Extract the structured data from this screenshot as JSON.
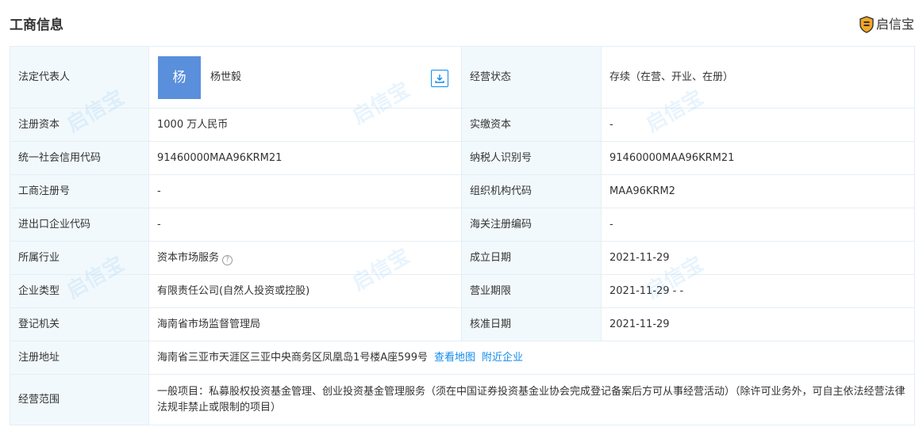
{
  "header": {
    "title": "工商信息",
    "brand": "启信宝"
  },
  "legal_rep": {
    "label": "法定代表人",
    "avatar_char": "杨",
    "name": "杨世毅"
  },
  "status": {
    "label": "经营状态",
    "value": "存续（在营、开业、在册）"
  },
  "rows": [
    {
      "l1": "注册资本",
      "v1": "1000 万人民币",
      "l2": "实缴资本",
      "v2": "-"
    },
    {
      "l1": "统一社会信用代码",
      "v1": "91460000MAA96KRM21",
      "l2": "纳税人识别号",
      "v2": "91460000MAA96KRM21"
    },
    {
      "l1": "工商注册号",
      "v1": "-",
      "l2": "组织机构代码",
      "v2": "MAA96KRM2"
    },
    {
      "l1": "进出口企业代码",
      "v1": "-",
      "l2": "海关注册编码",
      "v2": "-"
    },
    {
      "l1": "所属行业",
      "v1": "资本市场服务",
      "l2": "成立日期",
      "v2": "2021-11-29"
    },
    {
      "l1": "企业类型",
      "v1": "有限责任公司(自然人投资或控股)",
      "l2": "营业期限",
      "v2": "2021-11-29 - -"
    },
    {
      "l1": "登记机关",
      "v1": "海南省市场监督管理局",
      "l2": "核准日期",
      "v2": "2021-11-29"
    }
  ],
  "address": {
    "label": "注册地址",
    "value": "海南省三亚市天涯区三亚中央商务区凤凰岛1号楼A座599号",
    "map_link": "查看地图",
    "nearby_link": "附近企业"
  },
  "scope": {
    "label": "经营范围",
    "value": "一般项目：私募股权投资基金管理、创业投资基金管理服务（须在中国证券投资基金业协会完成登记备案后方可从事经营活动）（除许可业务外，可自主依法经营法律法规非禁止或限制的项目）"
  },
  "icons": {
    "download": "download-icon",
    "help": "help-circle-icon",
    "brand": "shield-logo-icon"
  },
  "colors": {
    "accent": "#128bed",
    "avatar": "#5a8fdc",
    "label_bg": "#f2f9fc",
    "border": "#e4eef6"
  }
}
